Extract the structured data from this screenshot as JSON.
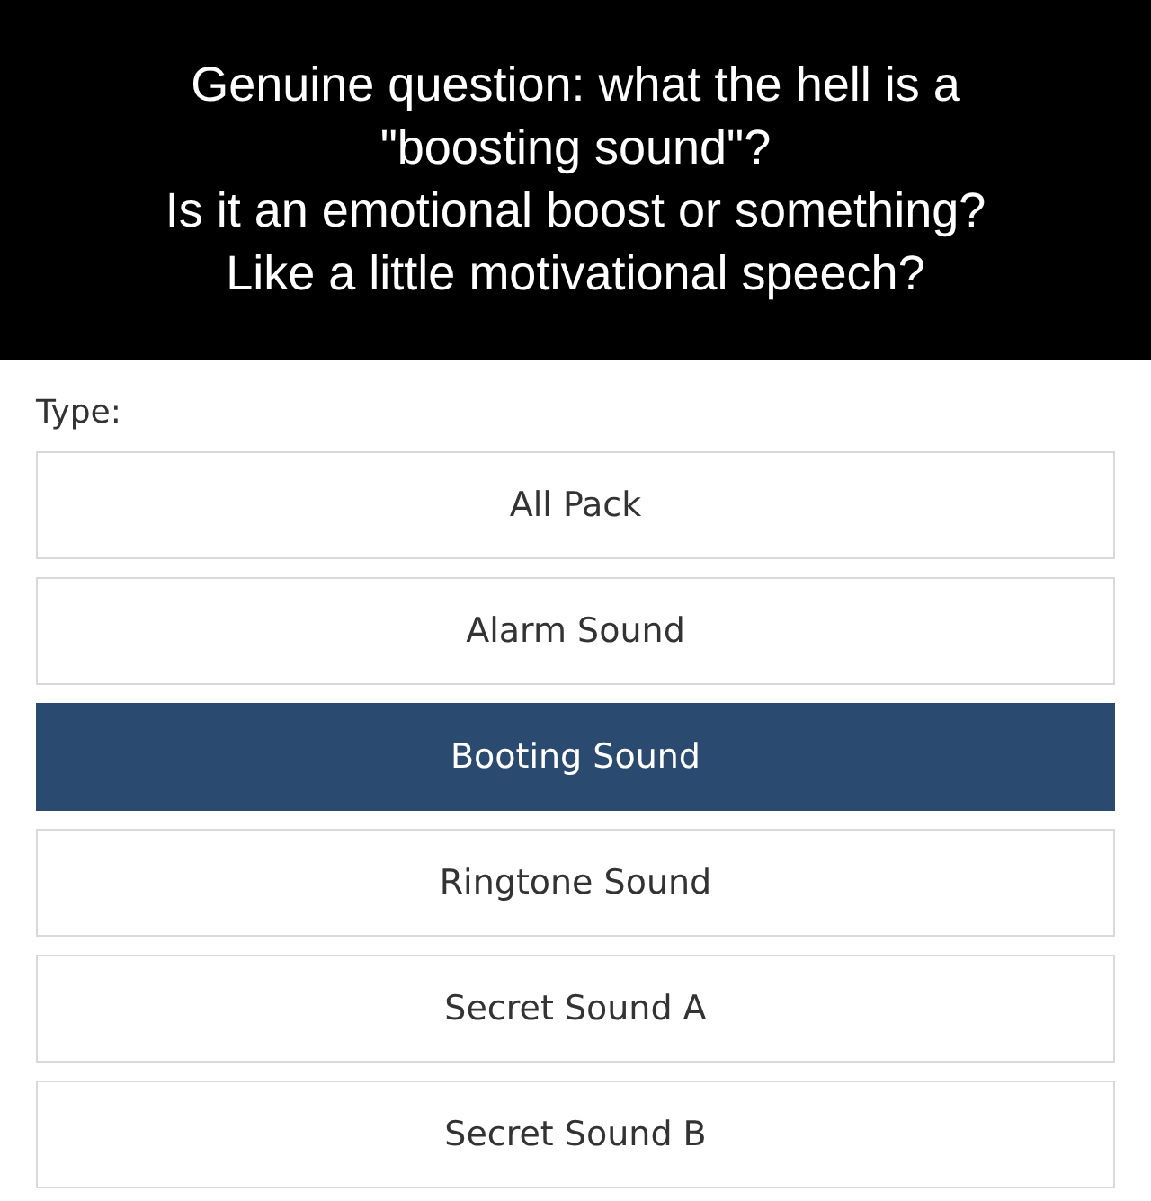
{
  "caption": "Genuine question: what the hell is a\n\"boosting sound\"?\nIs it an emotional boost or something?\nLike a little motivational speech?",
  "type_label": "Type:",
  "options": [
    {
      "label": "All Pack",
      "selected": false
    },
    {
      "label": "Alarm Sound",
      "selected": false
    },
    {
      "label": "Booting Sound",
      "selected": true
    },
    {
      "label": "Ringtone Sound",
      "selected": false
    },
    {
      "label": "Secret Sound A",
      "selected": false
    },
    {
      "label": "Secret Sound B",
      "selected": false
    }
  ]
}
